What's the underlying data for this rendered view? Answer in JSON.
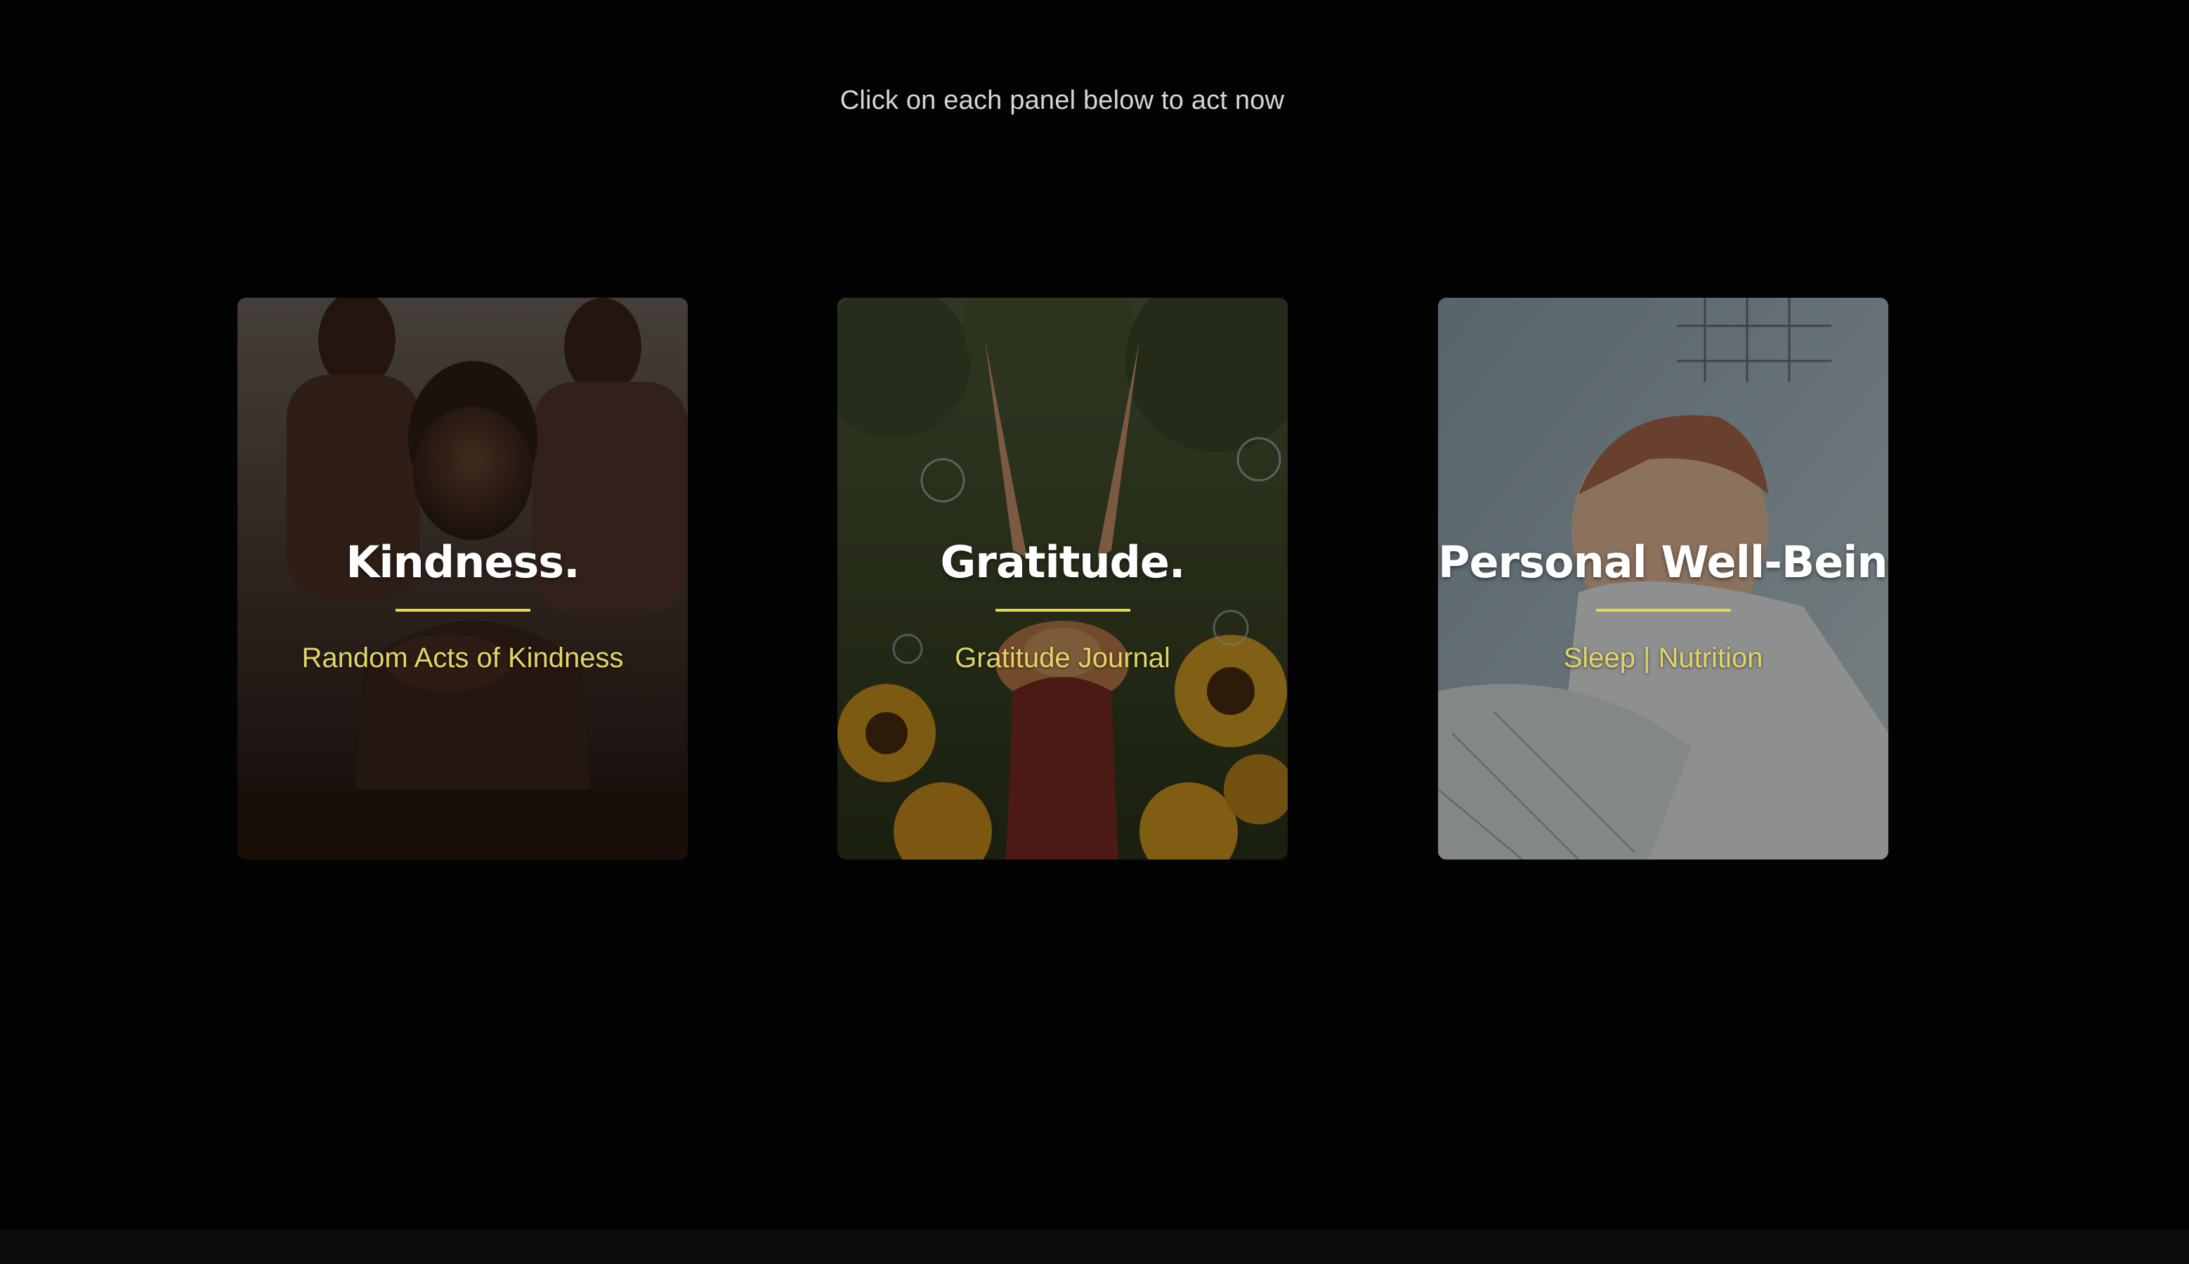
{
  "intro": {
    "text": "Click on each panel below to act now"
  },
  "panels": [
    {
      "title": "Kindness.",
      "subtitle": "Random Acts of Kindness",
      "photo_icon": "people-smiling-photo"
    },
    {
      "title": "Gratitude.",
      "subtitle": "Gratitude Journal",
      "photo_icon": "sunflower-field-photo"
    },
    {
      "title": "Personal Well-Being.",
      "subtitle": "Sleep | Nutrition",
      "photo_icon": "sleeping-baby-photo"
    }
  ],
  "colors": {
    "background": "#030303",
    "title": "#ffffff",
    "accent": "#e8d84a",
    "subtitle": "#e3d466",
    "intro_text": "#d6d6d6"
  }
}
